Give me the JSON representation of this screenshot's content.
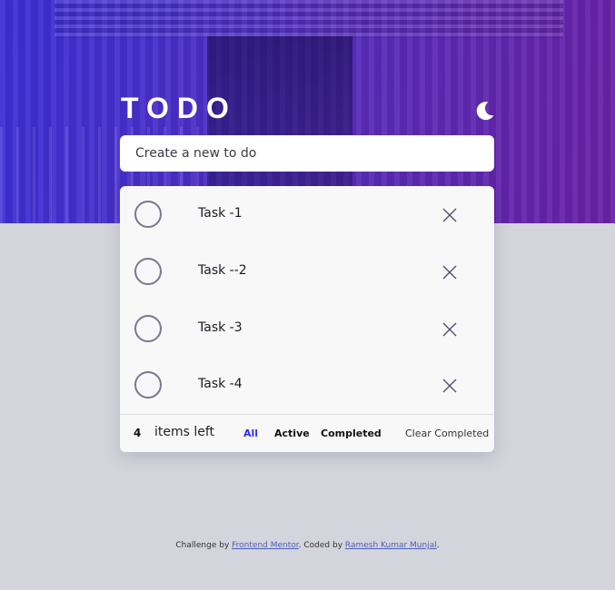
{
  "header": {
    "title": "TODO",
    "theme_icon": "moon-icon"
  },
  "new_todo": {
    "placeholder": "Create a new to do"
  },
  "tasks": [
    {
      "label": "Task -1",
      "completed": false
    },
    {
      "label": "Task --2",
      "completed": false
    },
    {
      "label": "Task -3",
      "completed": false
    },
    {
      "label": "Task -4",
      "completed": false
    }
  ],
  "footer": {
    "count": "4",
    "items_left": "items left",
    "filter_all": "All",
    "filter_active": "Active",
    "filter_completed": "Completed",
    "clear_completed": "Clear Completed"
  },
  "attribution": {
    "prefix": "Challenge by ",
    "link1": "Frontend Mentor",
    "middle": ". Coded by ",
    "link2": "Ramesh Kumar Munjal",
    "suffix": "."
  },
  "colors": {
    "accent": "#2d2df0",
    "background": "#d4d4dd",
    "card": "#f8f8f9",
    "hero_start": "#3b2fd6",
    "hero_end": "#6a22a6"
  }
}
